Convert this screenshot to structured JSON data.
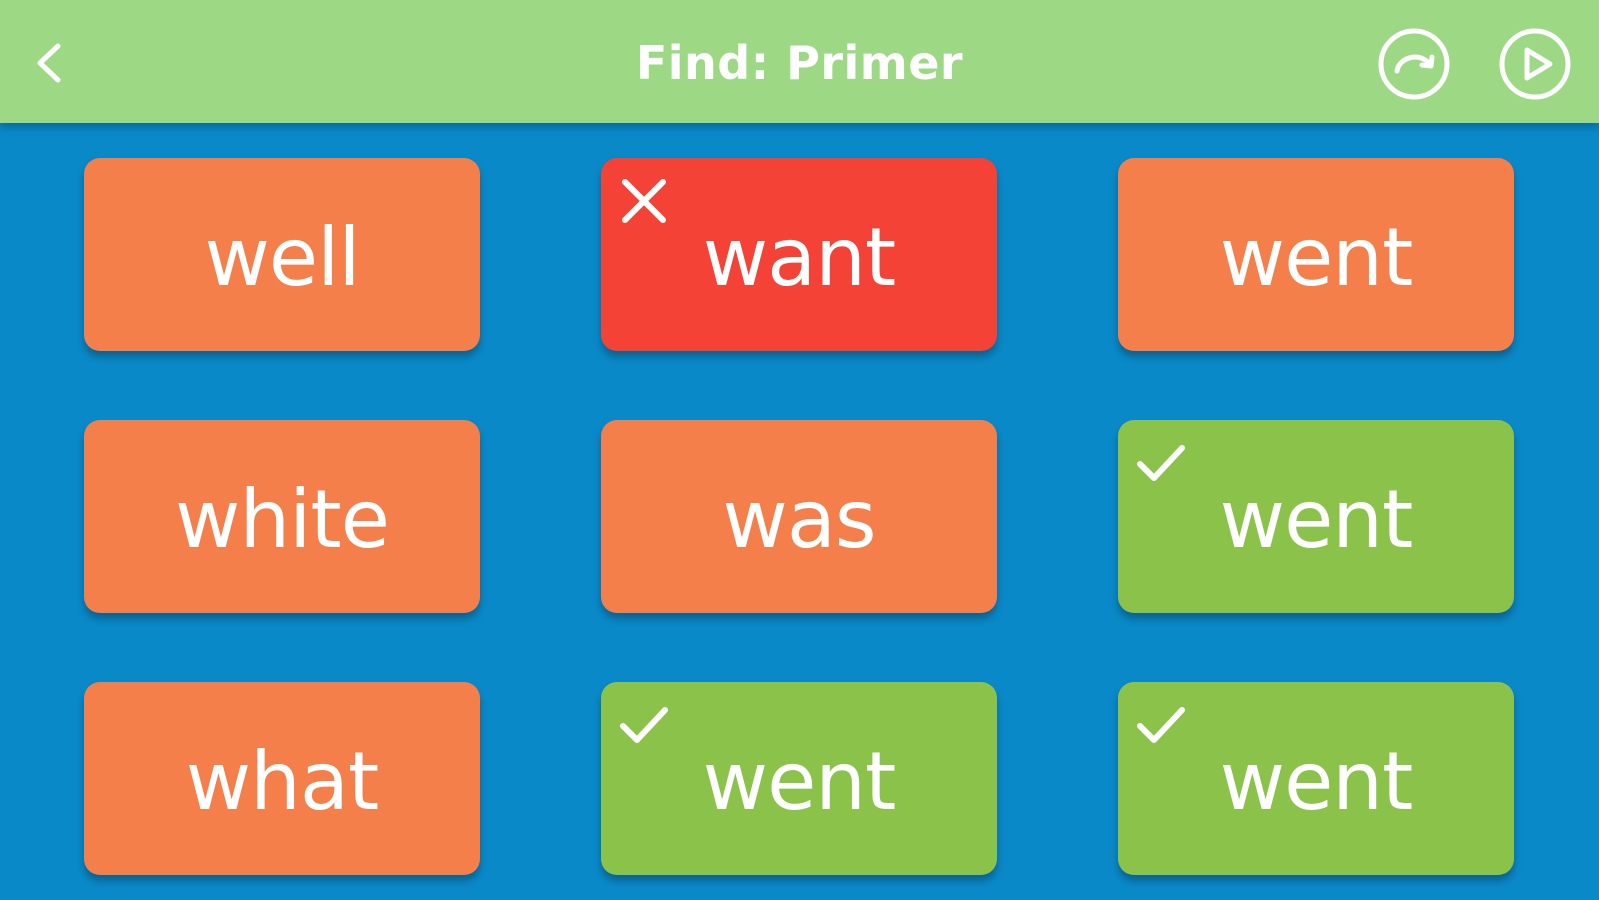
{
  "header": {
    "title": "Find: Primer",
    "back_icon": "chevron-left-icon",
    "redo_icon": "redo-icon",
    "play_icon": "play-icon",
    "background_color": "#9dd984"
  },
  "board": {
    "background_color": "#0a89c9",
    "tiles": [
      {
        "word": "well",
        "state": "neutral",
        "mark_icon": ""
      },
      {
        "word": "want",
        "state": "wrong",
        "mark_icon": "x-icon"
      },
      {
        "word": "went",
        "state": "neutral",
        "mark_icon": ""
      },
      {
        "word": "white",
        "state": "neutral",
        "mark_icon": ""
      },
      {
        "word": "was",
        "state": "neutral",
        "mark_icon": ""
      },
      {
        "word": "went",
        "state": "correct",
        "mark_icon": "check-icon"
      },
      {
        "word": "what",
        "state": "neutral",
        "mark_icon": ""
      },
      {
        "word": "went",
        "state": "correct",
        "mark_icon": "check-icon"
      },
      {
        "word": "went",
        "state": "correct",
        "mark_icon": "check-icon"
      }
    ],
    "state_colors": {
      "neutral": "#f47f4a",
      "wrong": "#f44336",
      "correct": "#8bc34a"
    }
  }
}
